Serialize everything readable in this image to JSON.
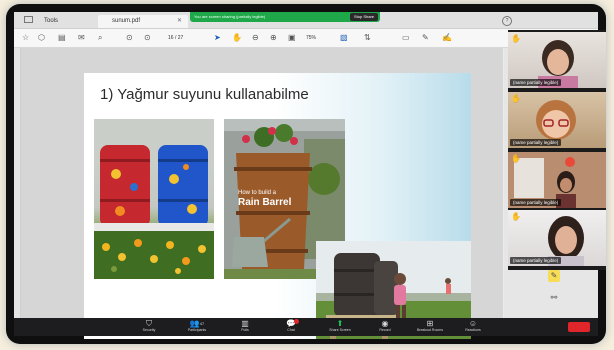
{
  "zoom_share_bar": {
    "status_text": "You are screen sharing (partially legible)",
    "stop_label": "Stop Share"
  },
  "tabs": {
    "tools": "Tools",
    "document": "sunum.pdf"
  },
  "pdf_toolbar": {
    "page_indicator": "16 / 27",
    "zoom_value": "75%"
  },
  "slide": {
    "title": "1) Yağmur suyunu kullanabilme",
    "photo_caption_line1": "How to build a",
    "photo_caption_line2": "Rain Barrel"
  },
  "participants": [
    {
      "name": "(name partially legible)",
      "hand_raised": true
    },
    {
      "name": "(name partially legible)",
      "hand_raised": true
    },
    {
      "name": "(name partially legible)",
      "hand_raised": true
    },
    {
      "name": "(name partially legible)",
      "hand_raised": true
    }
  ],
  "zoom_toolbar": {
    "security": "Security",
    "participants": "Participants",
    "participants_count": "47",
    "polls": "Polls",
    "chat": "Chat",
    "share_screen": "Share Screen",
    "record": "Record",
    "breakout_rooms": "Breakout Rooms",
    "reactions": "Reactions"
  },
  "colors": {
    "share_green": "#1fa84a",
    "zoom_bar": "#1d1d1f",
    "end_red": "#e0262b"
  },
  "icons": [
    "home-icon",
    "save-icon",
    "print-icon",
    "zoom-in-icon",
    "cursor-icon",
    "hand-icon",
    "help-icon",
    "shield-icon",
    "people-icon",
    "poll-icon",
    "chat-icon",
    "share-screen-icon",
    "record-icon",
    "breakout-icon",
    "reaction-icon",
    "raised-hand-icon"
  ]
}
